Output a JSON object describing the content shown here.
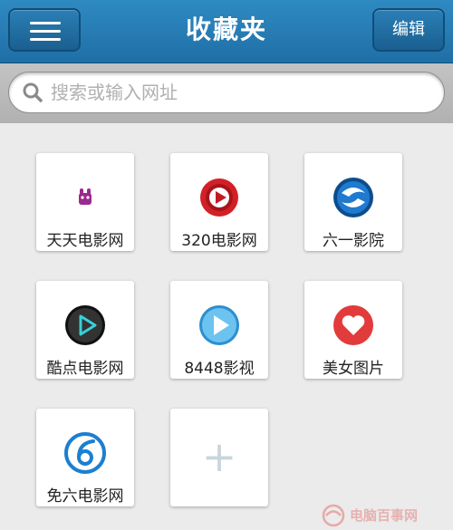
{
  "header": {
    "title": "收藏夹",
    "edit_label": "编辑"
  },
  "search": {
    "placeholder": "搜索或输入网址"
  },
  "favorites": [
    {
      "label": "天天电影网",
      "icon": "tiantian-icon",
      "color": "#9b2a8e"
    },
    {
      "label": "320电影网",
      "icon": "play-red-icon",
      "color": "#d32027"
    },
    {
      "label": "六一影院",
      "icon": "swirl-blue-icon",
      "color": "#1565b0"
    },
    {
      "label": "酷点电影网",
      "icon": "play-black-icon",
      "color": "#222222"
    },
    {
      "label": "8448影视",
      "icon": "play-lightblue-icon",
      "color": "#3aa3df"
    },
    {
      "label": "美女图片",
      "icon": "heart-icon",
      "color": "#e23b3b"
    },
    {
      "label": "免六电影网",
      "icon": "number-six-icon",
      "color": "#1c7fd0"
    }
  ],
  "add_tile": {
    "symbol": "+"
  },
  "watermark": {
    "text": "电脑百事网"
  },
  "colors": {
    "header": "#1f6fa6",
    "background": "#ebebeb"
  }
}
